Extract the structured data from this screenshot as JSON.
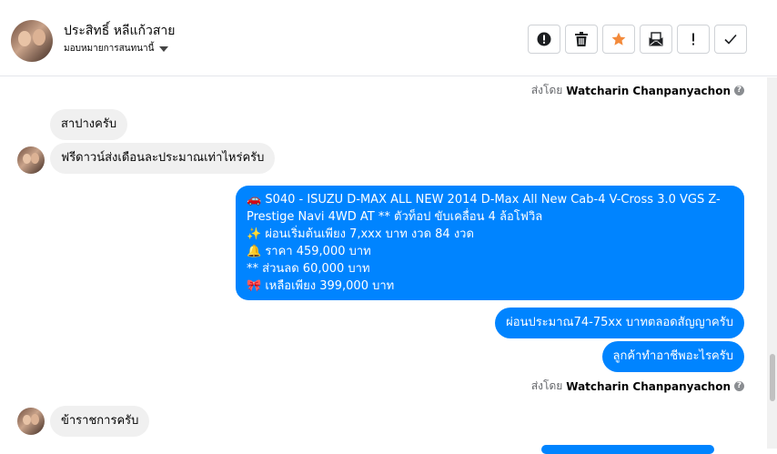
{
  "header": {
    "name": "ประสิทธิ์ หลีแก้วสาย",
    "assign_label": "มอบหมายการสนทนานี้"
  },
  "toolbar": {
    "buttons": [
      {
        "name": "mark-spam",
        "icon": "exclamation-circle-icon"
      },
      {
        "name": "delete",
        "icon": "trash-icon"
      },
      {
        "name": "star",
        "icon": "star-icon",
        "color": "#f38a3b"
      },
      {
        "name": "archive",
        "icon": "envelope-icon"
      },
      {
        "name": "follow-up",
        "icon": "exclamation-icon"
      },
      {
        "name": "done",
        "icon": "check-icon"
      }
    ]
  },
  "messages": {
    "sent_by_prefix": "ส่งโดย",
    "sent_by_name": "Watcharin Chanpanyachon",
    "in_1": "สาปางครับ",
    "in_2": "ฟรีดาวน์ส่งเดือนละประมาณเท่าไหร่ครับ",
    "out_big_lines": [
      "🚗 S040 - ISUZU D-MAX ALL NEW 2014 D-Max All New Cab-4 V-Cross 3.0 VGS Z-",
      "Prestige Navi 4WD AT  ** ตัวท็อป ขับเคลื่อน 4 ล้อโฟวิล",
      "✨ ผ่อนเริ่มต้นเพียง 7,xxx บาท งวด 84 งวด",
      "🔔 ราคา 459,000 บาท",
      "** ส่วนลด 60,000 บาท",
      "🎀 เหลือเพียง 399,000 บาท"
    ],
    "out_2": "ผ่อนประมาณ74-75xx บาทตลอดสัญญาครับ",
    "out_3": "ลูกค้าทำอาชีพอะไรครับ",
    "in_3": "ข้าราชการครับ"
  },
  "colors": {
    "outgoing_bubble": "#0084ff",
    "incoming_bubble": "#f0f0f0",
    "star": "#f38a3b"
  }
}
